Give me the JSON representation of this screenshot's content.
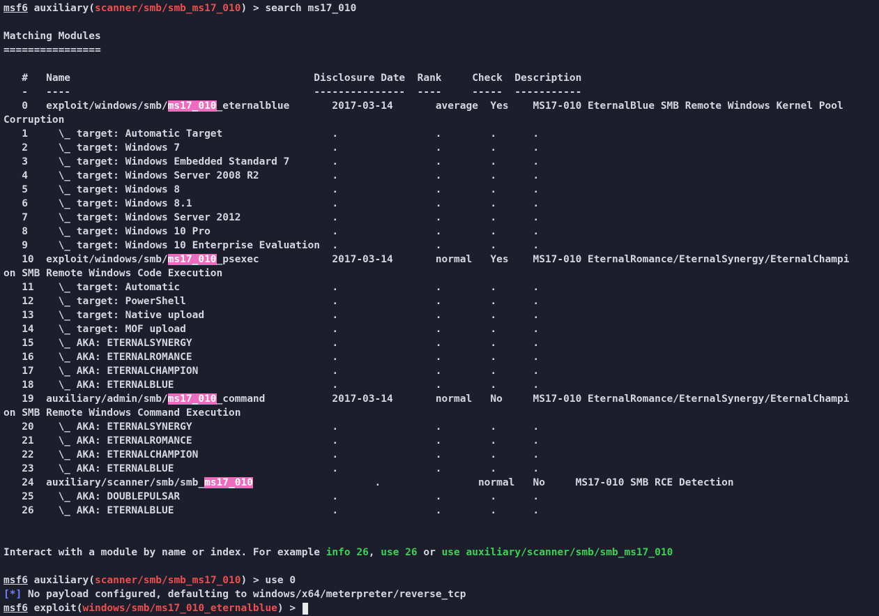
{
  "prompt1": {
    "msf": "msf6",
    "mod_prefix": "auxiliary(",
    "mod_path": "scanner/smb/smb_ms17_010",
    "mod_suffix": ") > ",
    "command": "search ms17_010"
  },
  "heading": {
    "title": "Matching Modules",
    "rule": "================"
  },
  "table": {
    "header": "   #   Name                                        Disclosure Date  Rank     Check  Description",
    "underline": "   -   ----                                        ---------------  ----     -----  -----------",
    "search_term": "ms17_010",
    "rows": [
      {
        "pre": "   0   exploit/windows/smb/",
        "post": "_eternalblue       2017-03-14       average  Yes    MS17-010 EternalBlue SMB Remote Windows Kernel Pool"
      },
      {
        "text": "Corruption"
      },
      {
        "text": "   1     \\_ target: Automatic Target                  .                .        .      ."
      },
      {
        "text": "   2     \\_ target: Windows 7                         .                .        .      ."
      },
      {
        "text": "   3     \\_ target: Windows Embedded Standard 7       .                .        .      ."
      },
      {
        "text": "   4     \\_ target: Windows Server 2008 R2            .                .        .      ."
      },
      {
        "text": "   5     \\_ target: Windows 8                         .                .        .      ."
      },
      {
        "text": "   6     \\_ target: Windows 8.1                       .                .        .      ."
      },
      {
        "text": "   7     \\_ target: Windows Server 2012               .                .        .      ."
      },
      {
        "text": "   8     \\_ target: Windows 10 Pro                    .                .        .      ."
      },
      {
        "text": "   9     \\_ target: Windows 10 Enterprise Evaluation  .                .        .      ."
      },
      {
        "pre": "   10  exploit/windows/smb/",
        "post": "_psexec            2017-03-14       normal   Yes    MS17-010 EternalRomance/EternalSynergy/EternalChampi"
      },
      {
        "text": "on SMB Remote Windows Code Execution"
      },
      {
        "text": "   11    \\_ target: Automatic                         .                .        .      ."
      },
      {
        "text": "   12    \\_ target: PowerShell                        .                .        .      ."
      },
      {
        "text": "   13    \\_ target: Native upload                     .                .        .      ."
      },
      {
        "text": "   14    \\_ target: MOF upload                        .                .        .      ."
      },
      {
        "text": "   15    \\_ AKA: ETERNALSYNERGY                       .                .        .      ."
      },
      {
        "text": "   16    \\_ AKA: ETERNALROMANCE                       .                .        .      ."
      },
      {
        "text": "   17    \\_ AKA: ETERNALCHAMPION                      .                .        .      ."
      },
      {
        "text": "   18    \\_ AKA: ETERNALBLUE                          .                .        .      ."
      },
      {
        "pre": "   19  auxiliary/admin/smb/",
        "post": "_command           2017-03-14       normal   No     MS17-010 EternalRomance/EternalSynergy/EternalChampi"
      },
      {
        "text": "on SMB Remote Windows Command Execution"
      },
      {
        "text": "   20    \\_ AKA: ETERNALSYNERGY                       .                .        .      ."
      },
      {
        "text": "   21    \\_ AKA: ETERNALROMANCE                       .                .        .      ."
      },
      {
        "text": "   22    \\_ AKA: ETERNALCHAMPION                      .                .        .      ."
      },
      {
        "text": "   23    \\_ AKA: ETERNALBLUE                          .                .        .      ."
      },
      {
        "pre": "   24  auxiliary/scanner/smb/smb_",
        "post": "                    .                normal   No     MS17-010 SMB RCE Detection"
      },
      {
        "text": "   25    \\_ AKA: DOUBLEPULSAR                         .                .        .      ."
      },
      {
        "text": "   26    \\_ AKA: ETERNALBLUE                          .                .        .      ."
      }
    ]
  },
  "interact": {
    "text1": "Interact with a module by name or index. For example ",
    "g1": "info 26",
    "text2": ", ",
    "g2": "use 26",
    "text3": " or ",
    "g3": "use auxiliary/scanner/smb/smb_ms17_010"
  },
  "prompt2": {
    "msf": "msf6",
    "mod_prefix": "auxiliary(",
    "mod_path": "scanner/smb/smb_ms17_010",
    "mod_suffix": ") > ",
    "command": "use 0"
  },
  "info_line": {
    "tag": "[*]",
    "text": " No payload configured, defaulting to windows/x64/meterpreter/reverse_tcp"
  },
  "prompt3": {
    "msf": "msf6",
    "mod_prefix": "exploit(",
    "mod_path": "windows/smb/ms17_010_eternalblue",
    "mod_suffix": ") > "
  },
  "colors": {
    "background": "#1c1e2b",
    "foreground": "#d3d7df",
    "module_path": "#ed4f4f",
    "highlight": "#ee6bbf",
    "link_green": "#39d353",
    "info_blue": "#6e83ff"
  }
}
